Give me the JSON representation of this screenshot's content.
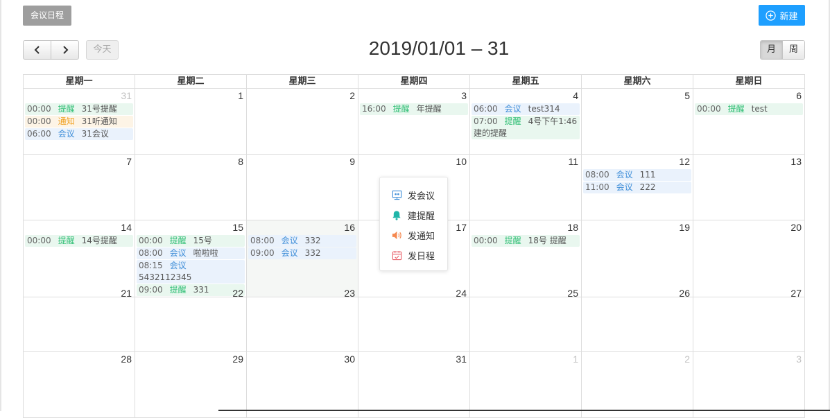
{
  "toolbar": {
    "tab_label": "会议日程",
    "new_label": "新建",
    "today_label": "今天",
    "title": "2019/01/01 – 31",
    "view_month": "月",
    "view_week": "周"
  },
  "weekdays": [
    "星期一",
    "星期二",
    "星期三",
    "星期四",
    "星期五",
    "星期六",
    "星期日"
  ],
  "event_types": {
    "remind": "提醒",
    "notice": "通知",
    "meeting": "会议"
  },
  "weeks": [
    [
      {
        "n": "31",
        "other": true,
        "events": [
          {
            "time": "00:00",
            "kind": "remind",
            "label": "提醒",
            "text": "31号提醒"
          },
          {
            "time": "00:00",
            "kind": "notice",
            "label": "通知",
            "text": "31听通知"
          },
          {
            "time": "06:00",
            "kind": "meeting",
            "label": "会议",
            "text": "31会议"
          }
        ]
      },
      {
        "n": "1",
        "events": []
      },
      {
        "n": "2",
        "events": []
      },
      {
        "n": "3",
        "events": [
          {
            "time": "16:00",
            "kind": "remind",
            "label": "提醒",
            "text": "年提醒"
          }
        ]
      },
      {
        "n": "4",
        "events": [
          {
            "time": "06:00",
            "kind": "meeting",
            "label": "会议",
            "text": "test314"
          },
          {
            "time": "07:00",
            "kind": "remind",
            "label": "提醒",
            "text": "4号下午1:46建的提醒"
          }
        ]
      },
      {
        "n": "5",
        "events": []
      },
      {
        "n": "6",
        "events": [
          {
            "time": "00:00",
            "kind": "remind",
            "label": "提醒",
            "text": "test"
          }
        ]
      }
    ],
    [
      {
        "n": "7",
        "events": []
      },
      {
        "n": "8",
        "events": []
      },
      {
        "n": "9",
        "events": []
      },
      {
        "n": "10",
        "events": []
      },
      {
        "n": "11",
        "events": []
      },
      {
        "n": "12",
        "events": [
          {
            "time": "08:00",
            "kind": "meeting",
            "label": "会议",
            "text": "111"
          },
          {
            "time": "11:00",
            "kind": "meeting",
            "label": "会议",
            "text": "222"
          }
        ]
      },
      {
        "n": "13",
        "events": []
      }
    ],
    [
      {
        "n": "14",
        "events": [
          {
            "time": "00:00",
            "kind": "remind",
            "label": "提醒",
            "text": "14号提醒"
          }
        ]
      },
      {
        "n": "15",
        "events": [
          {
            "time": "00:00",
            "kind": "remind",
            "label": "提醒",
            "text": "15号"
          },
          {
            "time": "08:00",
            "kind": "meeting",
            "label": "会议",
            "text": "啦啦啦"
          },
          {
            "time": "08:15",
            "kind": "meeting",
            "label": "会议",
            "text": "5432112345"
          },
          {
            "time": "09:00",
            "kind": "remind",
            "label": "提醒",
            "text": "331"
          }
        ]
      },
      {
        "n": "16",
        "highlight": true,
        "events": [
          {
            "time": "08:00",
            "kind": "meeting",
            "label": "会议",
            "text": "332"
          },
          {
            "time": "09:00",
            "kind": "meeting",
            "label": "会议",
            "text": "332"
          }
        ]
      },
      {
        "n": "17",
        "events": []
      },
      {
        "n": "18",
        "events": [
          {
            "time": "00:00",
            "kind": "remind",
            "label": "提醒",
            "text": "18号 提醒"
          }
        ]
      },
      {
        "n": "19",
        "events": []
      },
      {
        "n": "20",
        "events": []
      }
    ],
    [
      {
        "n": "21",
        "events": []
      },
      {
        "n": "22",
        "events": []
      },
      {
        "n": "23",
        "events": []
      },
      {
        "n": "24",
        "events": []
      },
      {
        "n": "25",
        "events": []
      },
      {
        "n": "26",
        "events": []
      },
      {
        "n": "27",
        "events": []
      }
    ],
    [
      {
        "n": "28",
        "events": []
      },
      {
        "n": "29",
        "events": []
      },
      {
        "n": "30",
        "events": []
      },
      {
        "n": "31",
        "events": []
      },
      {
        "n": "1",
        "other": true,
        "events": []
      },
      {
        "n": "2",
        "other": true,
        "events": []
      },
      {
        "n": "3",
        "other": true,
        "events": []
      }
    ]
  ],
  "popup": {
    "items": [
      {
        "label": "发会议",
        "icon": "meeting-icon"
      },
      {
        "label": "建提醒",
        "icon": "bell-icon"
      },
      {
        "label": "发通知",
        "icon": "speaker-icon"
      },
      {
        "label": "发日程",
        "icon": "calendar-icon"
      }
    ]
  }
}
